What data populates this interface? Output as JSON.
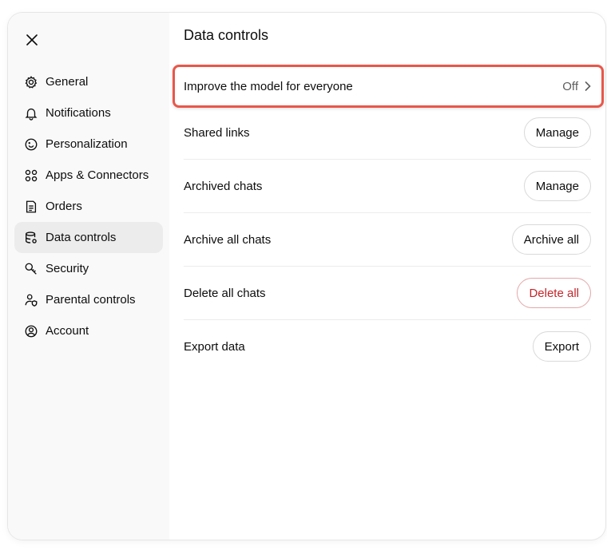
{
  "sidebar": {
    "items": [
      {
        "label": "General",
        "icon": "gear-icon"
      },
      {
        "label": "Notifications",
        "icon": "bell-icon"
      },
      {
        "label": "Personalization",
        "icon": "smile-icon"
      },
      {
        "label": "Apps & Connectors",
        "icon": "apps-icon"
      },
      {
        "label": "Orders",
        "icon": "receipt-icon"
      },
      {
        "label": "Data controls",
        "icon": "database-icon",
        "active": true
      },
      {
        "label": "Security",
        "icon": "key-icon"
      },
      {
        "label": "Parental controls",
        "icon": "person-shield-icon"
      },
      {
        "label": "Account",
        "icon": "user-circle-icon"
      }
    ]
  },
  "main": {
    "title": "Data controls",
    "improve": {
      "label": "Improve the model for everyone",
      "value": "Off"
    },
    "rows": [
      {
        "label": "Shared links",
        "button": "Manage"
      },
      {
        "label": "Archived chats",
        "button": "Manage"
      },
      {
        "label": "Archive all chats",
        "button": "Archive all"
      },
      {
        "label": "Delete all chats",
        "button": "Delete all"
      },
      {
        "label": "Export data",
        "button": "Export"
      }
    ]
  },
  "colors": {
    "highlight": "#e8574a",
    "danger": "#c5252a",
    "sidebar_bg": "#f9f9f9",
    "active_bg": "#ececec"
  }
}
